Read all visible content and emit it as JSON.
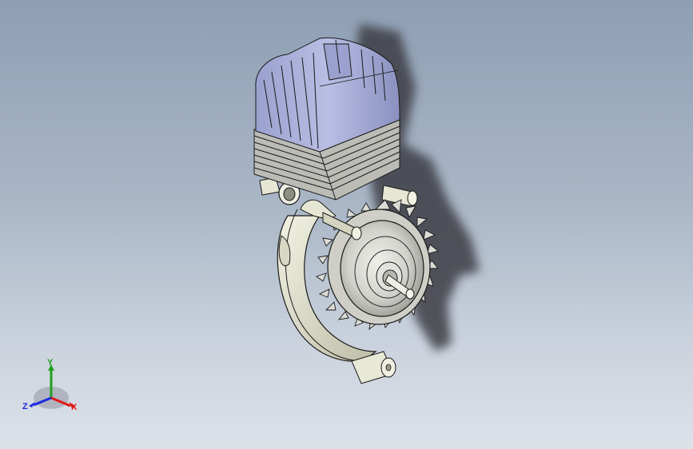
{
  "viewport": {
    "background_top": "#8e9fb4",
    "background_bottom": "#dde2e9"
  },
  "model": {
    "name_icon": "engine-3d-model",
    "colors": {
      "cylinder_head": "#aab0d8",
      "cylinder_head_shade": "#8c93c4",
      "cylinder_barrel": "#b8b8b2",
      "crankcase": "#e6e6d4",
      "crankcase_shade": "#c9c9b4",
      "flywheel": "#d9d9d4",
      "shadow": "#3d3d45"
    }
  },
  "triad": {
    "x_label": "X",
    "y_label": "Y",
    "z_label": "Z",
    "x_color": "#e01818",
    "y_color": "#1ea01e",
    "z_color": "#1a2ae0"
  }
}
